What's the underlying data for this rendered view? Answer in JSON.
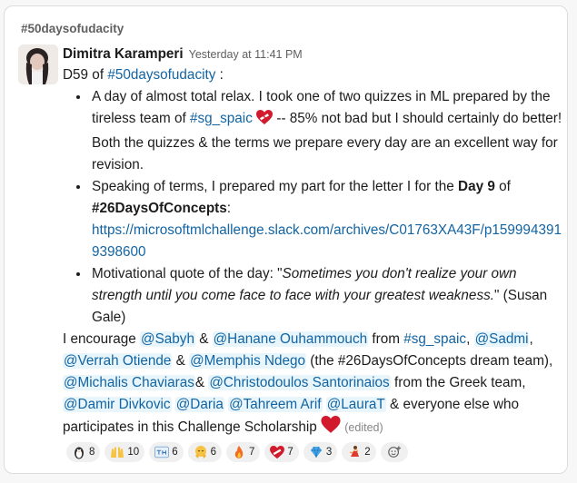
{
  "channel": "#50daysofudacity",
  "message": {
    "author": "Dimitra Karamperi",
    "timestamp": "Yesterday at 11:41 PM",
    "day_label": "D59 of ",
    "day_tag": "#50daysofudacity",
    "day_colon": " :",
    "bullet1": {
      "t1": "A day of almost total relax. I took one of two quizzes in ML prepared by the tireless team of ",
      "channel": "#sg_spaic",
      "t2": " -- 85% not bad but I should certainly do better! Both the quizzes & the terms we prepare every day are an excellent way for revision."
    },
    "bullet2": {
      "t1": "Speaking of terms, I prepared my part for the letter I for the ",
      "bold_day": "Day 9",
      "t2": " of ",
      "bold_tag": "#26DaysOfConcepts",
      "t3": ":",
      "url": "https://microsoftmlchallenge.slack.com/archives/C01763XA43F/p1599943919398600"
    },
    "bullet3": {
      "t1": "Motivational quote of the day: \"",
      "quote": "Sometimes you don't realize your own strength until you come face to face with your greatest weakness.",
      "t2": "\" (Susan Gale)"
    },
    "closing": {
      "t_encourage": "I encourage ",
      "m_sabyh": "@Sabyh",
      "t_amp1": " & ",
      "m_hanane": "@Hanane Ouhammouch",
      "t_from": " from ",
      "c_sg": "#sg_spaic",
      "t_comma1": ", ",
      "m_sadmi": "@Sadmi",
      "t_comma2": ",",
      "m_verrah": "@Verrah Otiende",
      "t_amp2": " & ",
      "m_memphis": "@Memphis Ndego",
      "t_dream": " (the #26DaysOfConcepts dream team), ",
      "m_michalis": "@Michalis Chaviaras",
      "t_amp3": "& ",
      "m_christodoulos": "@Christodoulos Santorinaios",
      "t_greek": " from the Greek team, ",
      "m_damir": "@Damir Divkovic",
      "t_sp1": " ",
      "m_daria": "@Daria",
      "t_sp2": " ",
      "m_tahreem": "@Tahreem Arif",
      "t_sp3": " ",
      "m_laurat": "@LauraT",
      "t_else": " & everyone else who participates in this Challenge Scholarship ",
      "edited": "(edited)"
    }
  },
  "reactions": [
    {
      "icon": "penguin-icon",
      "count": "8"
    },
    {
      "icon": "raised-hands-icon",
      "count": "10"
    },
    {
      "icon": "thank-you-icon",
      "count": "6"
    },
    {
      "icon": "hug-icon",
      "count": "6"
    },
    {
      "icon": "fire-icon",
      "count": "7"
    },
    {
      "icon": "mending-heart-icon",
      "count": "7"
    },
    {
      "icon": "gem-icon",
      "count": "3"
    },
    {
      "icon": "dancer-icon",
      "count": "2"
    }
  ],
  "colors": {
    "link": "#1264a3",
    "mention_bg": "#e8f5fa",
    "heart": "#d11b2c"
  }
}
